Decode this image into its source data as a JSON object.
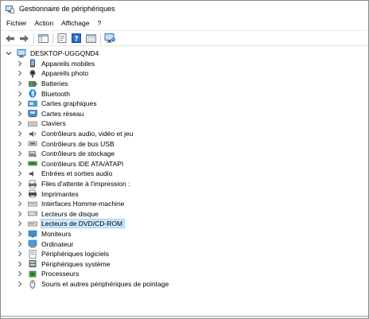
{
  "window": {
    "title": "Gestionnaire de périphériques"
  },
  "menu": [
    "Fichier",
    "Action",
    "Affichage",
    "?"
  ],
  "toolbar": [
    {
      "name": "back-button",
      "icon": "back-arrow-icon"
    },
    {
      "name": "forward-button",
      "icon": "forward-arrow-icon"
    },
    {
      "separator": true
    },
    {
      "name": "show-hide-console-tree-button",
      "icon": "console-tree-icon"
    },
    {
      "separator": true
    },
    {
      "name": "properties-button",
      "icon": "properties-icon"
    },
    {
      "name": "help-button",
      "icon": "help-icon"
    },
    {
      "name": "update-driver-button",
      "icon": "update-driver-icon"
    },
    {
      "separator": true
    },
    {
      "name": "scan-hardware-button",
      "icon": "monitor-scan-icon"
    }
  ],
  "tree": {
    "root": {
      "label": "DESKTOP-UGGQND4",
      "icon": "computer-icon",
      "expanded": true
    },
    "categories": [
      {
        "label": "Appareils mobiles",
        "icon": "mobile-device-icon"
      },
      {
        "label": "Appareils photo",
        "icon": "camera-icon"
      },
      {
        "label": "Batteries",
        "icon": "battery-icon"
      },
      {
        "label": "Bluetooth",
        "icon": "bluetooth-icon"
      },
      {
        "label": "Cartes graphiques",
        "icon": "display-adapter-icon"
      },
      {
        "label": "Cartes réseau",
        "icon": "network-adapter-icon"
      },
      {
        "label": "Claviers",
        "icon": "keyboard-icon"
      },
      {
        "label": "Contrôleurs audio, vidéo et jeu",
        "icon": "audio-controller-icon"
      },
      {
        "label": "Contrôleurs de bus USB",
        "icon": "usb-controller-icon"
      },
      {
        "label": "Contrôleurs de stockage",
        "icon": "storage-controller-icon"
      },
      {
        "label": "Contrôleurs IDE ATA/ATAPI",
        "icon": "ide-controller-icon"
      },
      {
        "label": "Entrées et sorties audio",
        "icon": "speaker-icon"
      },
      {
        "label": "Files d'attente à l'impression :",
        "icon": "print-queue-icon"
      },
      {
        "label": "Imprimantes",
        "icon": "printer-icon"
      },
      {
        "label": "Interfaces Homme-machine",
        "icon": "hid-icon"
      },
      {
        "label": "Lecteurs de disque",
        "icon": "disk-drive-icon"
      },
      {
        "label": "Lecteurs de DVD/CD-ROM",
        "icon": "dvd-drive-icon",
        "selected": true
      },
      {
        "label": "Moniteurs",
        "icon": "monitor-icon"
      },
      {
        "label": "Ordinateur",
        "icon": "computer-monitor-icon"
      },
      {
        "label": "Périphériques logiciels",
        "icon": "software-device-icon"
      },
      {
        "label": "Périphériques système",
        "icon": "system-device-icon"
      },
      {
        "label": "Processeurs",
        "icon": "processor-icon"
      },
      {
        "label": "Souris et autres périphériques de pointage",
        "icon": "mouse-icon"
      }
    ]
  },
  "colors": {
    "selection_bg": "#cce8ff",
    "selection_border": "#99d1ff",
    "accent_blue": "#1e7fd8"
  }
}
